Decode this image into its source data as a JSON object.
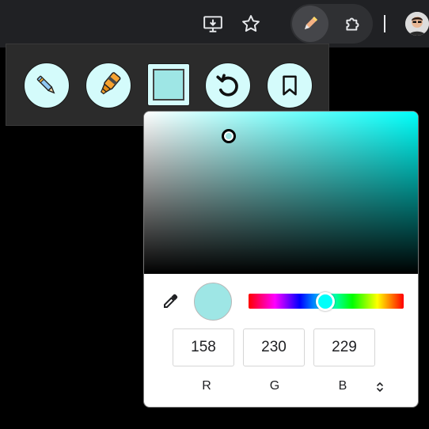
{
  "toolbar": {
    "icons": [
      "install-app-icon",
      "bookmark-star-icon",
      "pen-extension-icon",
      "extensions-puzzle-icon",
      "profile-avatar"
    ]
  },
  "palette": {
    "tools": [
      "pen-icon",
      "highlighter-icon",
      "color-swatch",
      "undo-icon",
      "bookmark-icon"
    ],
    "tool_bg_color": "#d4fbfb",
    "current_color": "#9ee6e5"
  },
  "picker": {
    "hue_color": "#00fffa",
    "hue_fraction": 0.493,
    "saturation": 0.31,
    "value": 0.9,
    "color": "#9ee6e5",
    "r": "158",
    "g": "230",
    "b": "229",
    "labels": {
      "r": "R",
      "g": "G",
      "b": "B"
    }
  }
}
